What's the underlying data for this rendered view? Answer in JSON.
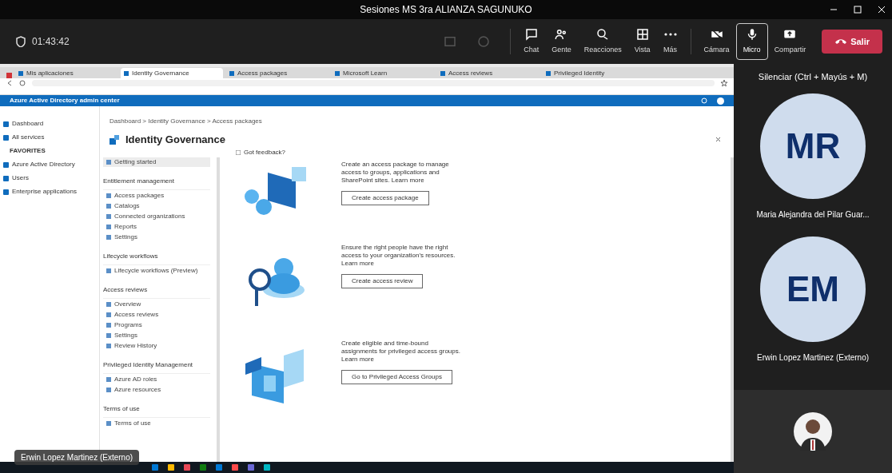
{
  "window": {
    "title": "Sesiones MS 3ra ALIANZA SAGUNUKO"
  },
  "meeting": {
    "timer": "01:43:42"
  },
  "toolbar": [
    {
      "kind": "chat",
      "label": "Chat",
      "selected": false
    },
    {
      "kind": "people",
      "label": "Gente",
      "selected": false
    },
    {
      "kind": "react",
      "label": "Reacciones",
      "selected": false
    },
    {
      "kind": "view",
      "label": "Vista",
      "selected": false
    },
    {
      "kind": "more",
      "label": "Más",
      "selected": false
    },
    {
      "kind": "camera",
      "label": "Cámara",
      "selected": false
    },
    {
      "kind": "mic",
      "label": "Micro",
      "selected": true
    },
    {
      "kind": "share",
      "label": "Compartir",
      "selected": false
    }
  ],
  "leave_button": "Salir",
  "tooltip": "Silenciar (Ctrl + Mayús + M)",
  "participants": [
    {
      "initials": "MR",
      "name": "Maria Alejandra del Pilar Guar..."
    },
    {
      "initials": "EM",
      "name": "Erwin Lopez Martinez (Externo)"
    }
  ],
  "presenter_label": "Erwin Lopez Martinez (Externo)",
  "shared_screen": {
    "browser_tabs": [
      {
        "title": "Mis aplicaciones",
        "selected": false
      },
      {
        "title": "Identity Governance",
        "selected": true
      },
      {
        "title": "Access packages",
        "selected": false
      },
      {
        "title": "Microsoft Learn",
        "selected": false
      },
      {
        "title": "Access reviews",
        "selected": false
      },
      {
        "title": "Privileged Identity",
        "selected": false
      }
    ],
    "portal_header": "Azure Active Directory admin center",
    "left_nav": [
      {
        "kind": "item",
        "label": "Dashboard"
      },
      {
        "kind": "item",
        "label": "All services"
      },
      {
        "kind": "heading",
        "label": "FAVORITES"
      },
      {
        "kind": "item",
        "label": "Azure Active Directory"
      },
      {
        "kind": "item",
        "label": "Users"
      },
      {
        "kind": "item",
        "label": "Enterprise applications"
      }
    ],
    "breadcrumb": "Dashboard > Identity Governance > Access packages",
    "page_title": "Identity Governance",
    "blade_menu": [
      {
        "kind": "item",
        "label": "Getting started",
        "selected": true
      },
      {
        "kind": "heading",
        "label": "Entitlement management"
      },
      {
        "kind": "item",
        "label": "Access packages",
        "selected": false
      },
      {
        "kind": "item",
        "label": "Catalogs",
        "selected": false
      },
      {
        "kind": "item",
        "label": "Connected organizations",
        "selected": false
      },
      {
        "kind": "item",
        "label": "Reports",
        "selected": false
      },
      {
        "kind": "item",
        "label": "Settings",
        "selected": false
      },
      {
        "kind": "heading",
        "label": "Lifecycle workflows"
      },
      {
        "kind": "item",
        "label": "Lifecycle workflows (Preview)",
        "selected": false
      },
      {
        "kind": "heading",
        "label": "Access reviews"
      },
      {
        "kind": "item",
        "label": "Overview",
        "selected": false
      },
      {
        "kind": "item",
        "label": "Access reviews",
        "selected": false
      },
      {
        "kind": "item",
        "label": "Programs",
        "selected": false
      },
      {
        "kind": "item",
        "label": "Settings",
        "selected": false
      },
      {
        "kind": "item",
        "label": "Review History",
        "selected": false
      },
      {
        "kind": "heading",
        "label": "Privileged Identity Management"
      },
      {
        "kind": "item",
        "label": "Azure AD roles",
        "selected": false
      },
      {
        "kind": "item",
        "label": "Azure resources",
        "selected": false
      },
      {
        "kind": "heading",
        "label": "Terms of use"
      },
      {
        "kind": "item",
        "label": "Terms of use",
        "selected": false
      }
    ],
    "feedback": "Got feedback?",
    "cards": [
      {
        "text": "Create an access package to manage access to groups, applications and SharePoint sites. Learn more",
        "button": "Create access package"
      },
      {
        "text": "Ensure the right people have the right access to your organization's resources. Learn more",
        "button": "Create access review"
      },
      {
        "text": "Create eligible and time-bound assignments for privileged access groups. Learn more",
        "button": "Go to Privileged Access Groups"
      }
    ]
  }
}
